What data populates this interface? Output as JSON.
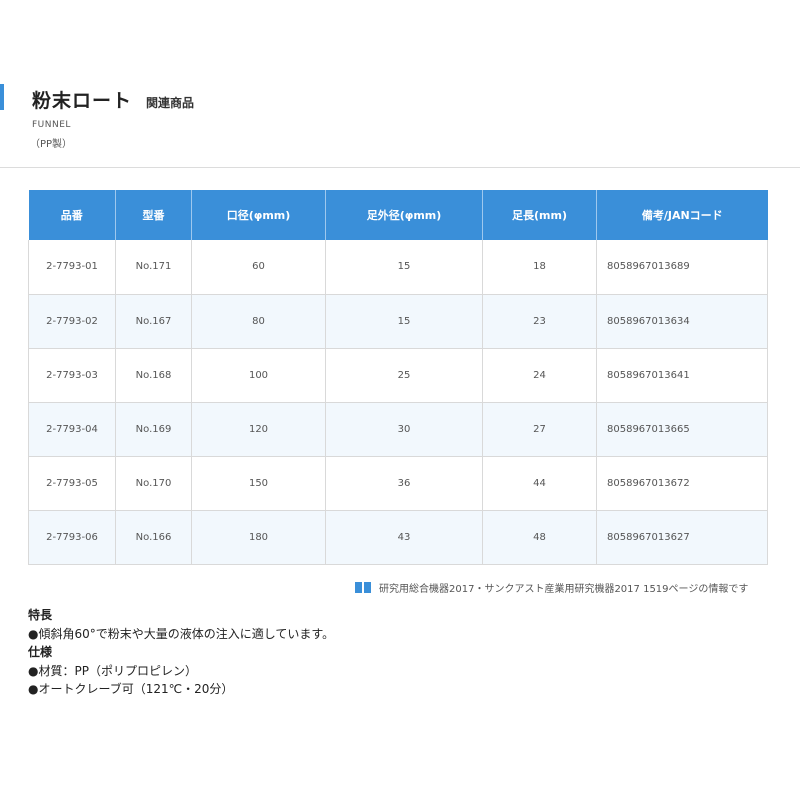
{
  "colors": {
    "accent": "#3a8fd9",
    "table_header_bg": "#3a8fd9",
    "zebra_row": "#f2f8fd"
  },
  "header": {
    "title": "粉末ロート",
    "related": "関連商品",
    "english_name": "FUNNEL",
    "material": "（PP製）"
  },
  "table": {
    "columns": [
      "品番",
      "型番",
      "口径(φmm)",
      "足外径(φmm)",
      "足長(mm)",
      "備考/JANコード"
    ],
    "rows": [
      {
        "part_no": "2-7793-01",
        "model": "No.171",
        "mouth": "60",
        "leg_od": "15",
        "leg_len": "18",
        "jan": "8058967013689"
      },
      {
        "part_no": "2-7793-02",
        "model": "No.167",
        "mouth": "80",
        "leg_od": "15",
        "leg_len": "23",
        "jan": "8058967013634"
      },
      {
        "part_no": "2-7793-03",
        "model": "No.168",
        "mouth": "100",
        "leg_od": "25",
        "leg_len": "24",
        "jan": "8058967013641"
      },
      {
        "part_no": "2-7793-04",
        "model": "No.169",
        "mouth": "120",
        "leg_od": "30",
        "leg_len": "27",
        "jan": "8058967013665"
      },
      {
        "part_no": "2-7793-05",
        "model": "No.170",
        "mouth": "150",
        "leg_od": "36",
        "leg_len": "44",
        "jan": "8058967013672"
      },
      {
        "part_no": "2-7793-06",
        "model": "No.166",
        "mouth": "180",
        "leg_od": "43",
        "leg_len": "48",
        "jan": "8058967013627"
      }
    ]
  },
  "source_note": {
    "icon": "book-icon",
    "text": "研究用総合機器2017・サンクアスト産業用研究機器2017 1519ページの情報です"
  },
  "features": {
    "heading": "特長",
    "items": [
      "●傾斜角60°で粉末や大量の液体の注入に適しています。"
    ]
  },
  "specs": {
    "heading": "仕様",
    "items": [
      "●材質：PP（ポリプロピレン）",
      "●オートクレーブ可（121℃・20分）"
    ]
  }
}
